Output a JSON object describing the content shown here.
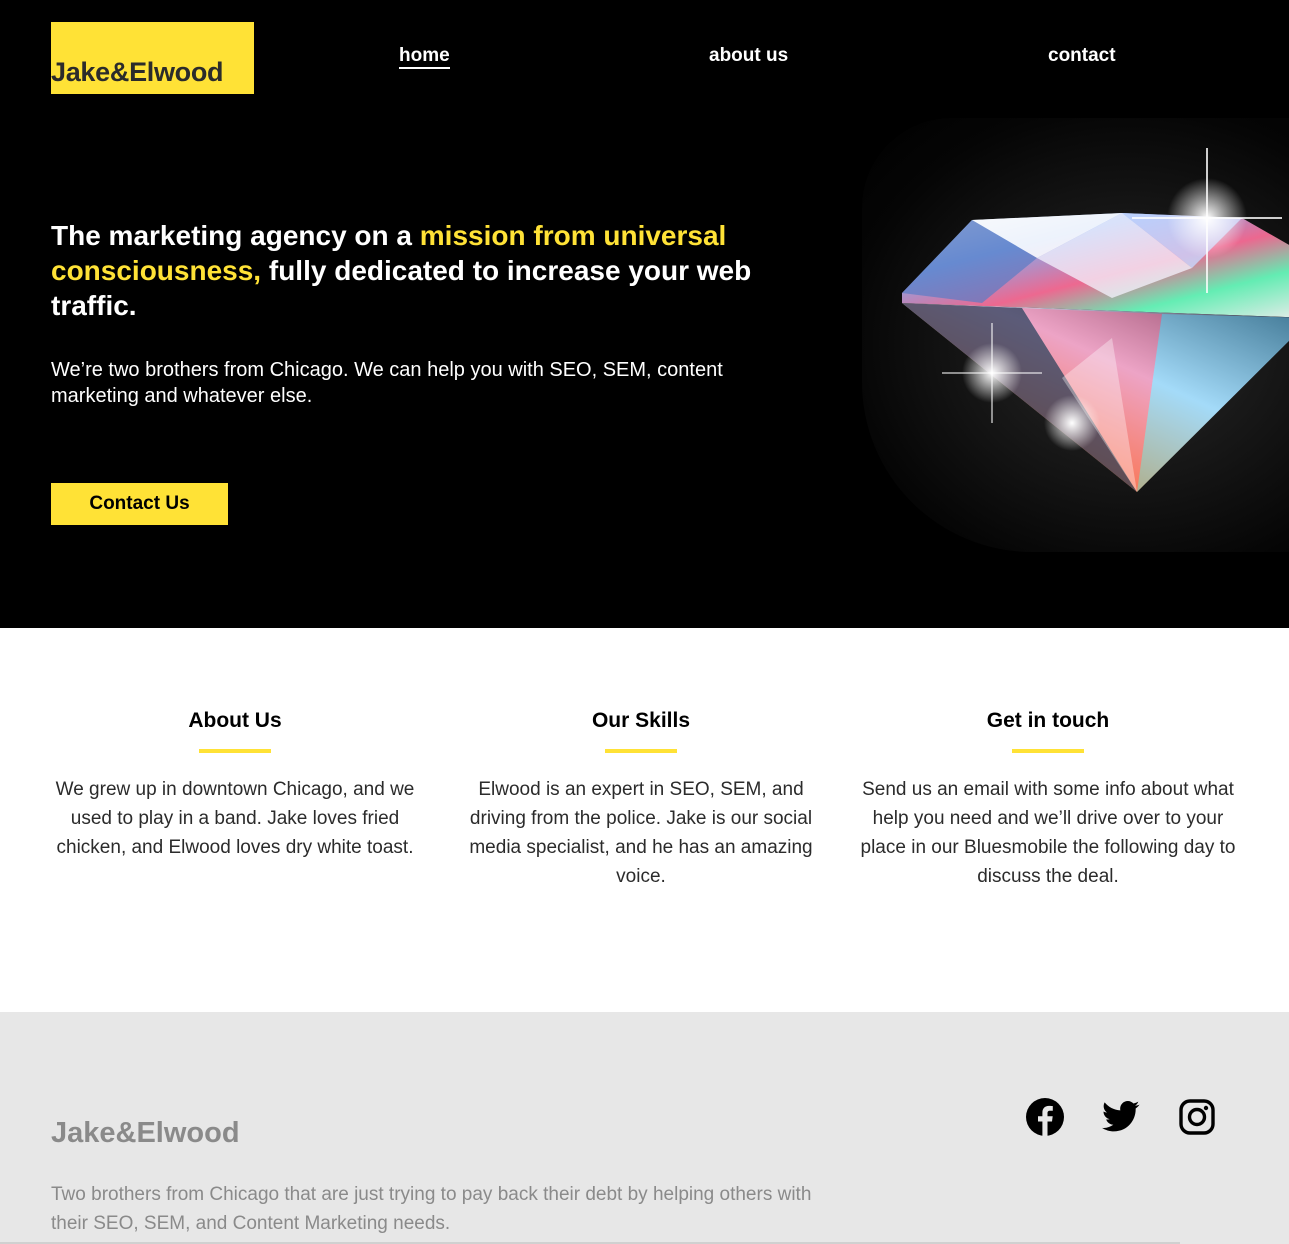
{
  "brand": {
    "name": "Jake&Elwood",
    "accent": "#ffe236"
  },
  "nav": {
    "home": "home",
    "about": "about us",
    "contact": "contact"
  },
  "hero": {
    "headline_pre": "The marketing agency on a ",
    "headline_highlight": "mission from universal consciousness,",
    "headline_post": " fully dedicated to increase your web traffic.",
    "subtext": "We’re two brothers from Chicago. We can help you with SEO, SEM, content marketing and whatever else.",
    "cta": "Contact Us",
    "image_icon": "diamond-image"
  },
  "features": [
    {
      "title": "About Us",
      "text": "We grew up in downtown Chicago, and we used to play in a band. Jake loves fried chicken, and Elwood loves dry white toast."
    },
    {
      "title": "Our Skills",
      "text": "Elwood is an expert in SEO, SEM, and driving from the police. Jake is our social media specialist, and he has an amazing voice."
    },
    {
      "title": "Get in touch",
      "text": "Send us an email with some info about what help you need and we’ll drive over to your place in our Bluesmobile the following day to discuss the deal."
    }
  ],
  "footer": {
    "brand": "Jake&Elwood",
    "description": "Two brothers from Chicago that are just trying to pay back their debt by helping others with their SEO, SEM, and Content Marketing needs.",
    "social": [
      "facebook-icon",
      "twitter-icon",
      "instagram-icon"
    ]
  }
}
